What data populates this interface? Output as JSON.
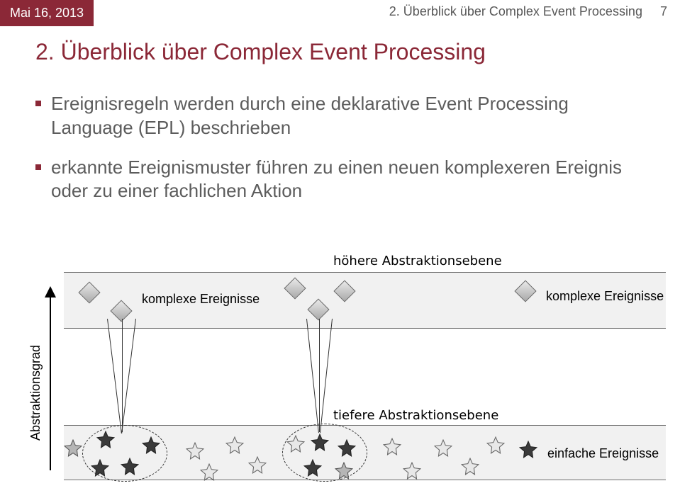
{
  "header": {
    "date": "Mai 16, 2013",
    "section": "2. Überblick über Complex Event Processing",
    "page": "7"
  },
  "title": "2. Überblick über Complex Event Processing",
  "bullets": [
    "Ereignisregeln werden durch eine deklarative Event Processing Language (EPL) beschrieben",
    "erkannte Ereignismuster führen zu einen neuen komplexeren Ereignis oder zu einer fachlichen Aktion"
  ],
  "diagram": {
    "higher_level": "höhere Abstraktionsebene",
    "lower_level": "tiefere Abstraktionsebene",
    "complex_events_left": "komplexe Ereignisse",
    "complex_events_right": "komplexe Ereignisse",
    "simple_events": "einfache Ereignisse",
    "axis": "Abstraktionsgrad"
  }
}
